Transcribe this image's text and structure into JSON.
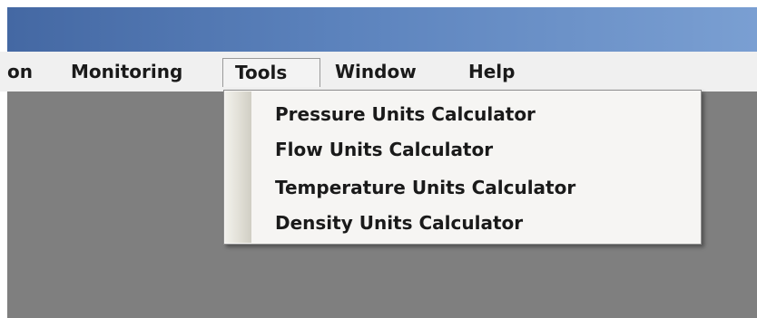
{
  "menu_bar": {
    "items": [
      {
        "label": "on"
      },
      {
        "label": "Monitoring"
      },
      {
        "label": "Tools",
        "active": true
      },
      {
        "label": "Window"
      },
      {
        "label": "Help"
      }
    ]
  },
  "tools_menu": {
    "items": [
      {
        "label": "Pressure Units Calculator"
      },
      {
        "label": "Flow Units Calculator"
      },
      {
        "label": "Temperature Units Calculator"
      },
      {
        "label": "Density Units Calculator"
      }
    ]
  },
  "colors": {
    "title_bar_start": "#4468a3",
    "title_bar_end": "#7a9fd2",
    "menu_bar_bg": "#f0f0f0",
    "workspace_bg": "#7f7f7f",
    "dropdown_bg": "#f6f5f3"
  }
}
